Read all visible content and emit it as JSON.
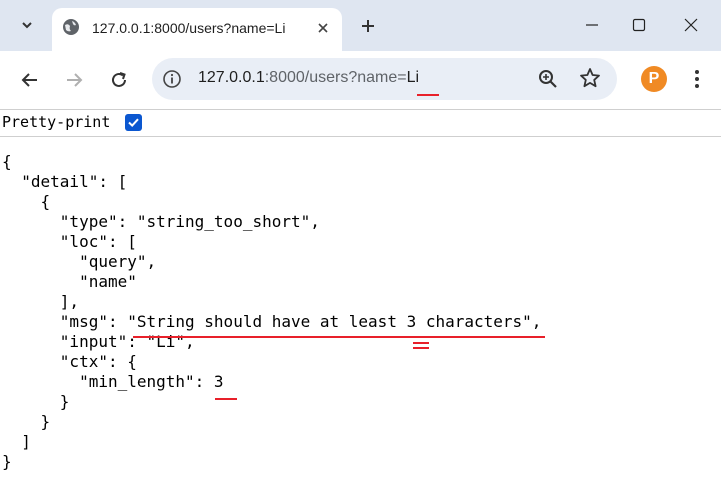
{
  "tab": {
    "title": "127.0.0.1:8000/users?name=Li"
  },
  "omnibox": {
    "host": "127.0.0.1",
    "rest": ":8000/users?name=",
    "query_value": "Li"
  },
  "extension": {
    "letter": "P",
    "color": "#f08a24"
  },
  "pretty_print": {
    "label": "Pretty-print",
    "checked": true
  },
  "json_lines": [
    "{",
    "  \"detail\": [",
    "    {",
    "      \"type\": \"string_too_short\",",
    "      \"loc\": [",
    "        \"query\",",
    "        \"name\"",
    "      ],",
    "      \"msg\": \"String should have at least 3 characters\",",
    "      \"input\": \"Li\",",
    "      \"ctx\": {",
    "        \"min_length\": 3",
    "      }",
    "    }",
    "  ]",
    "}"
  ],
  "colors": {
    "annotation": "#e8202a",
    "accent": "#0b57d0",
    "tab_strip": "#dfe6f1",
    "omnibox": "#e9eef6"
  }
}
